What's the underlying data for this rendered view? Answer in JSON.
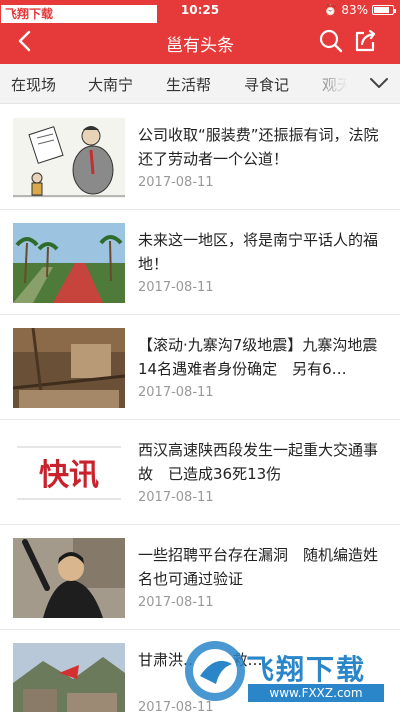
{
  "status": {
    "time": "10:25",
    "battery": "83%",
    "battery_level": 0.83
  },
  "watermark_top": "飞翔下载 www.FXXZ.com",
  "header": {
    "title": "邕有头条"
  },
  "tabs": [
    "在现场",
    "大南宁",
    "生活帮",
    "寻食记",
    "观天"
  ],
  "articles": [
    {
      "title": "公司收取“服装费”还振振有词，法院还了劳动者一个公道！",
      "date": "2017-08-11"
    },
    {
      "title": "未来这一地区，将是南宁平话人的福地！",
      "date": "2017-08-11"
    },
    {
      "title": "【滚动·九寨沟7级地震】九寨沟地震14名遇难者身份确定　另有6…",
      "date": "2017-08-11"
    },
    {
      "title": "西汉高速陕西段发生一起重大交通事故　已造成36死13伤",
      "date": "2017-08-11",
      "thumb_text": "快讯"
    },
    {
      "title": "一些招聘平台存在漏洞　随机编造姓名也可通过验证",
      "date": "2017-08-11"
    },
    {
      "title": "甘肃洪… IV级救…",
      "date": "2017-08-11"
    }
  ],
  "watermark_bottom": {
    "brand": "飞翔下载",
    "url": "www.FXXZ.com"
  },
  "colors": {
    "brand_red": "#e63a3a",
    "tab_bg": "#f3f3f3",
    "date_gray": "#999999"
  }
}
